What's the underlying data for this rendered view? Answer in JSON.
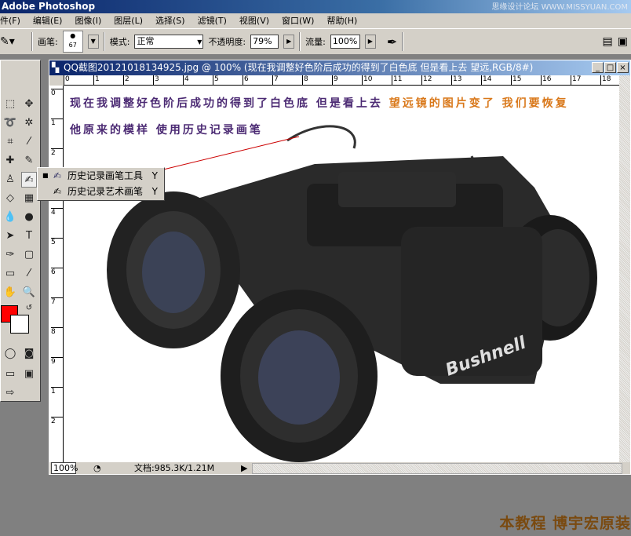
{
  "app": {
    "title": "Adobe Photoshop",
    "watermark": "思缘设计论坛 WWW.MISSYUAN.COM"
  },
  "menu": [
    "件(F)",
    "编辑(E)",
    "图像(I)",
    "图层(L)",
    "选择(S)",
    "滤镜(T)",
    "视图(V)",
    "窗口(W)",
    "帮助(H)"
  ],
  "options": {
    "brush_label": "画笔:",
    "brush_size": "67",
    "mode_label": "模式:",
    "mode_value": "正常",
    "opacity_label": "不透明度:",
    "opacity_value": "79%",
    "flow_label": "流量:",
    "flow_value": "100%"
  },
  "document": {
    "title": "QQ截图20121018134925.jpg @ 100% (现在我调整好色阶后成功的得到了白色底    但是看上去  望远,RGB/8#)",
    "ruler_h": [
      "0",
      "1",
      "2",
      "3",
      "4",
      "5",
      "6",
      "7",
      "8",
      "9",
      "10",
      "11",
      "12",
      "13",
      "14",
      "15",
      "16",
      "17",
      "18"
    ],
    "ruler_v": [
      "0",
      "1",
      "2",
      "3",
      "4",
      "5",
      "6",
      "7",
      "8",
      "9",
      "1",
      "2"
    ],
    "zoom": "100%",
    "doc_size": "文档:985.3K/1.21M"
  },
  "annotation": {
    "line1a": "现在我调整好色阶后成功的得到了白色底  但是看上去 ",
    "line1b": "望远镜的图片变了 我们要恢复",
    "line2": "他原来的模样  使用历史记录画笔"
  },
  "flyout": [
    {
      "label": "历史记录画笔工具",
      "key": "Y"
    },
    {
      "label": "历史记录艺术画笔",
      "key": "Y"
    }
  ],
  "product_brand": "Bushnell",
  "footer_watermark": "本教程 博宇宏原装",
  "colors": {
    "foreground": "#ff0000",
    "background": "#ffffff"
  }
}
